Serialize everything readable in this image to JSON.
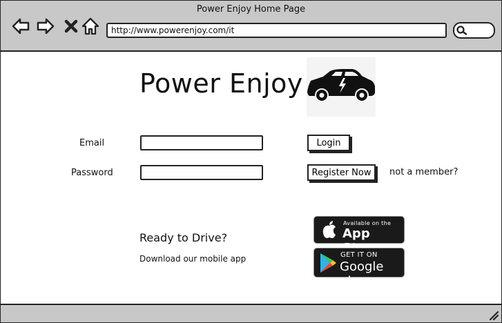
{
  "window": {
    "title": "Power Enjoy Home Page",
    "url": "http://www.powerenjoy.com/it"
  },
  "page": {
    "title": "Power Enjoy",
    "email_label": "Email",
    "password_label": "Password",
    "email_value": "",
    "password_value": "",
    "login_button": "Login",
    "register_button": "Register Now",
    "member_text": "not a member?",
    "ready_title": "Ready to Drive?",
    "ready_subtitle": "Download our mobile app"
  },
  "app_store": {
    "small": "Available on the",
    "big": "App Store"
  },
  "google_play": {
    "small": "GET IT ON",
    "big": "Google play"
  },
  "icons": [
    "back-arrow-icon",
    "forward-arrow-icon",
    "close-icon",
    "home-icon",
    "search-icon",
    "car-icon",
    "apple-icon",
    "play-icon",
    "resize-grip-icon"
  ],
  "colors": {
    "chrome": "#c8c8c8",
    "border": "#222222",
    "badge": "#1a1a1a"
  }
}
